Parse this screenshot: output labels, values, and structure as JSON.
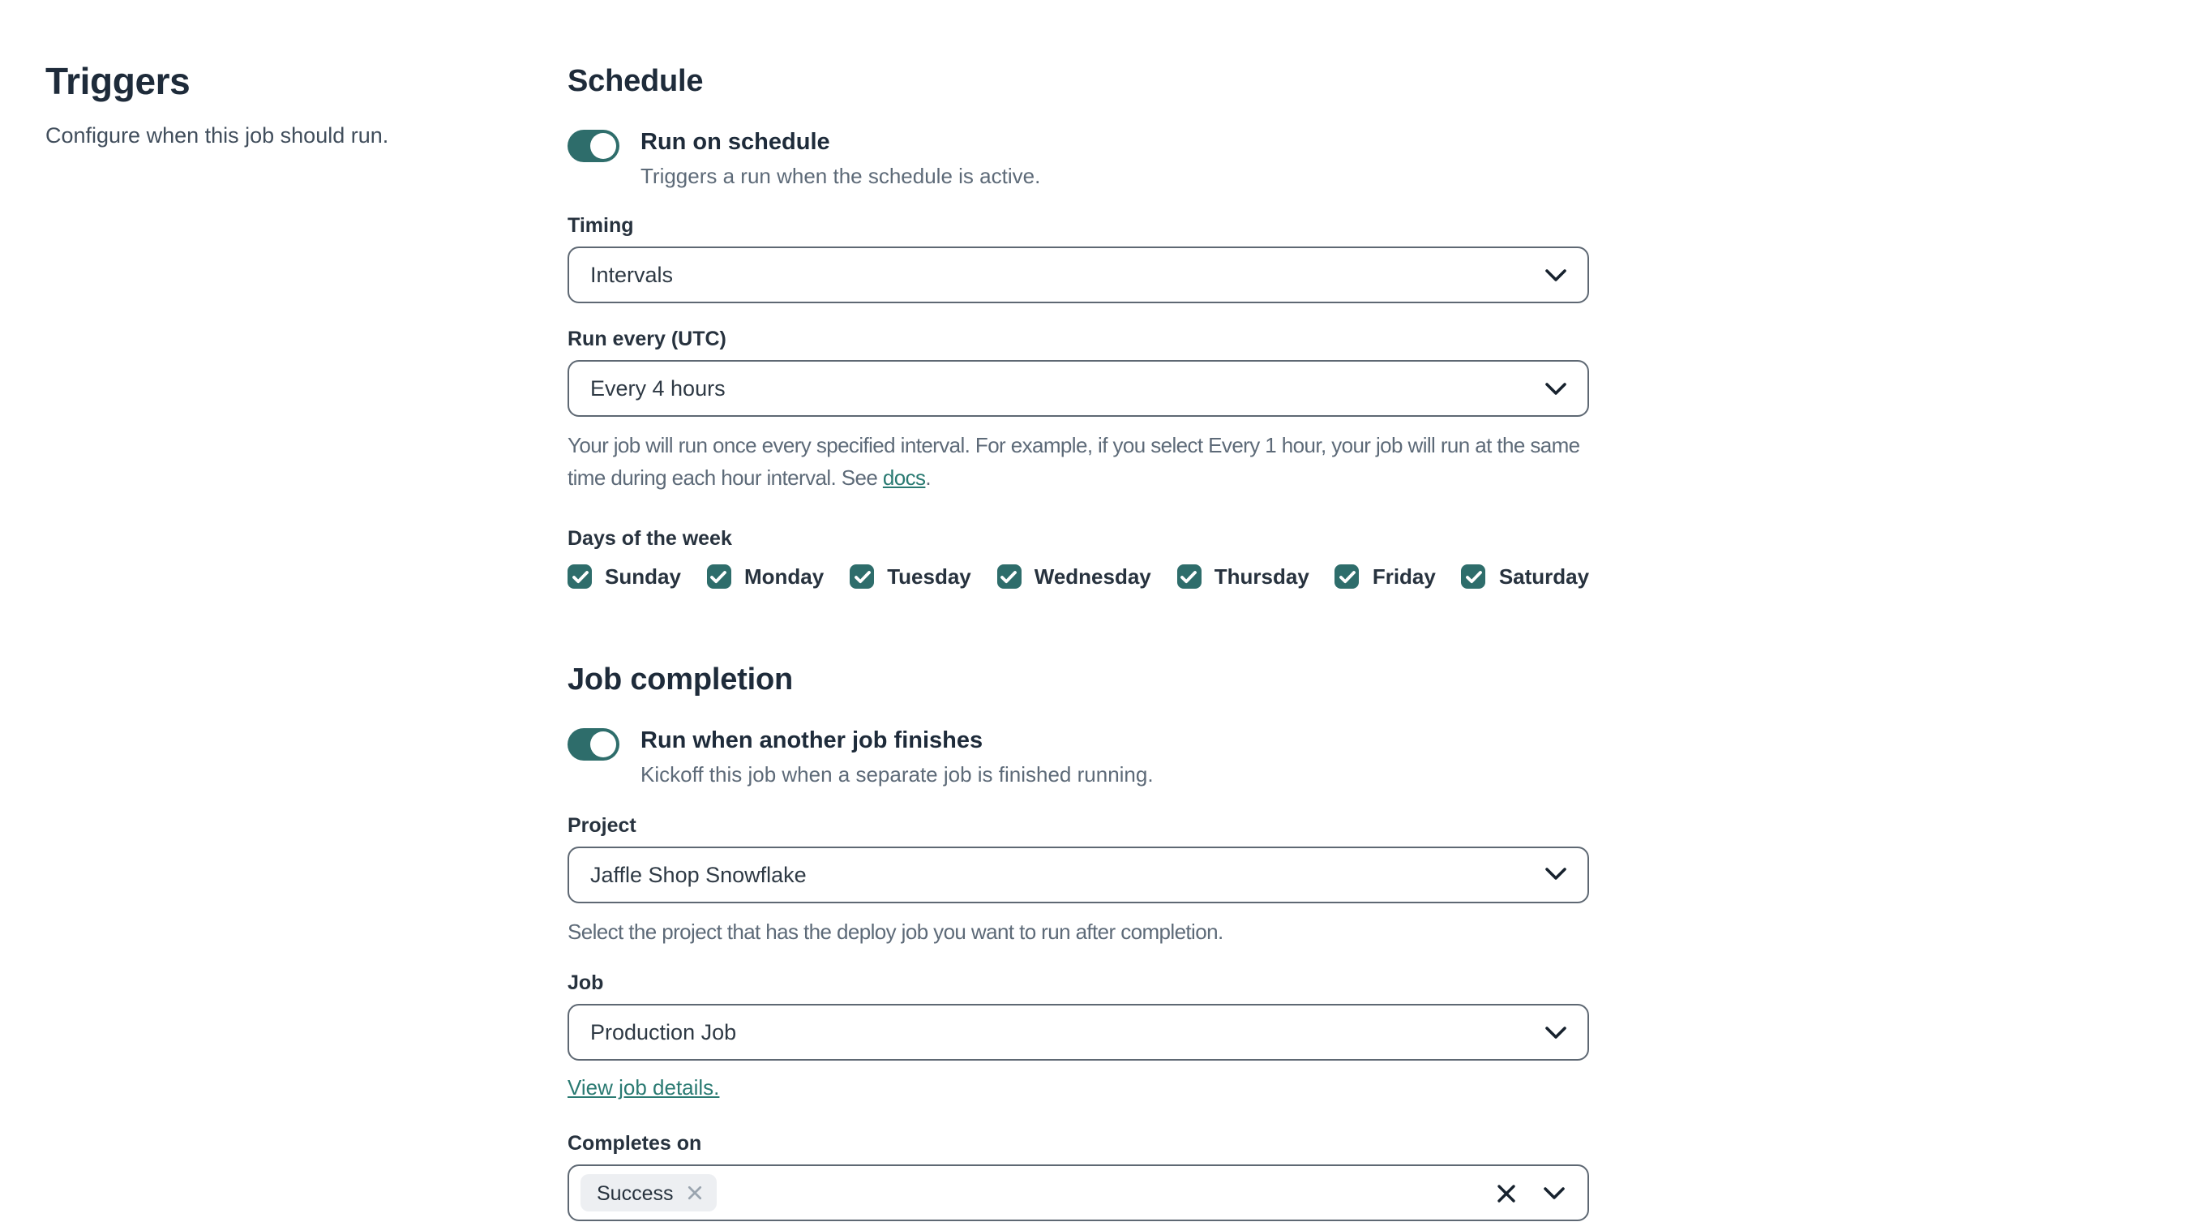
{
  "sidebar": {
    "title": "Triggers",
    "description": "Configure when this job should run."
  },
  "schedule": {
    "heading": "Schedule",
    "toggle": {
      "label": "Run on schedule",
      "description": "Triggers a run when the schedule is active.",
      "state": "on"
    },
    "timing": {
      "label": "Timing",
      "value": "Intervals"
    },
    "run_every": {
      "label": "Run every (UTC)",
      "value": "Every 4 hours",
      "help_text": "Your job will run once every specified interval. For example, if you select Every 1 hour, your job will run at the same time during each hour interval. See ",
      "help_link": "docs",
      "help_suffix": "."
    },
    "days_of_week": {
      "label": "Days of the week",
      "items": [
        {
          "label": "Sunday",
          "checked": true
        },
        {
          "label": "Monday",
          "checked": true
        },
        {
          "label": "Tuesday",
          "checked": true
        },
        {
          "label": "Wednesday",
          "checked": true
        },
        {
          "label": "Thursday",
          "checked": true
        },
        {
          "label": "Friday",
          "checked": true
        },
        {
          "label": "Saturday",
          "checked": true
        }
      ]
    }
  },
  "job_completion": {
    "heading": "Job completion",
    "toggle": {
      "label": "Run when another job finishes",
      "description": "Kickoff this job when a separate job is finished running.",
      "state": "on"
    },
    "project": {
      "label": "Project",
      "value": "Jaffle Shop Snowflake",
      "help": "Select the project that has the deploy job you want to run after completion."
    },
    "job": {
      "label": "Job",
      "value": "Production Job",
      "link_label": "View job details."
    },
    "completes_on": {
      "label": "Completes on",
      "selected": [
        {
          "label": "Success"
        }
      ]
    }
  },
  "icons": {
    "select_chevron": "chevron-down",
    "checkbox_check": "check",
    "chip_remove": "x",
    "clear_selection": "x"
  },
  "colors": {
    "accent_teal": "#2E6D6B",
    "link_teal": "#2A7A72",
    "border": "#5E6873",
    "heading_text": "#1E2B3A",
    "muted_text": "#5D6A78",
    "chip_background": "#EDEFF2"
  }
}
